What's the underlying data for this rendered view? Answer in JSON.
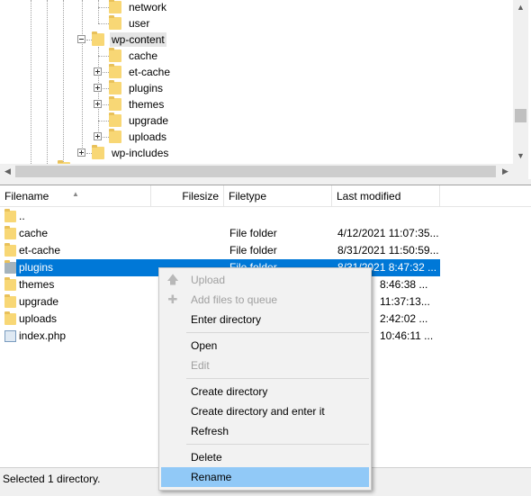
{
  "tree": {
    "nodes": [
      {
        "label": "network"
      },
      {
        "label": "user"
      },
      {
        "label": "wp-content"
      },
      {
        "label": "cache"
      },
      {
        "label": "et-cache"
      },
      {
        "label": "plugins"
      },
      {
        "label": "themes"
      },
      {
        "label": "upgrade"
      },
      {
        "label": "uploads"
      },
      {
        "label": "wp-includes"
      }
    ]
  },
  "file_list": {
    "columns": {
      "filename": "Filename",
      "filesize": "Filesize",
      "filetype": "Filetype",
      "last_modified": "Last modified"
    },
    "rows": [
      {
        "name": "..",
        "type": "",
        "modified": ""
      },
      {
        "name": "cache",
        "type": "File folder",
        "modified": "4/12/2021 11:07:35..."
      },
      {
        "name": "et-cache",
        "type": "File folder",
        "modified": "8/31/2021 11:50:59..."
      },
      {
        "name": "plugins",
        "type": "File folder",
        "modified": "8/31/2021 8:47:32 ..."
      },
      {
        "name": "themes",
        "type": "",
        "modified": "8:46:38 ..."
      },
      {
        "name": "upgrade",
        "type": "",
        "modified": "11:37:13..."
      },
      {
        "name": "uploads",
        "type": "",
        "modified": "2:42:02 ..."
      },
      {
        "name": "index.php",
        "type": "",
        "modified": "10:46:11 ..."
      }
    ]
  },
  "status": {
    "text": "Selected 1 directory."
  },
  "context_menu": {
    "upload": "Upload",
    "add_to_queue": "Add files to queue",
    "enter_directory": "Enter directory",
    "open": "Open",
    "edit": "Edit",
    "create_directory": "Create directory",
    "create_directory_enter": "Create directory and enter it",
    "refresh": "Refresh",
    "delete": "Delete",
    "rename": "Rename"
  },
  "icons": {
    "folder": "folder-icon",
    "file": "php-file-icon",
    "upload": "upload-arrow-icon",
    "add_queue": "add-to-queue-icon",
    "expand": "plus-expander-icon",
    "collapse": "minus-expander-icon"
  },
  "colors": {
    "selection": "#0078d7",
    "menu_highlight": "#91c9f7",
    "folder": "#f8d775"
  }
}
